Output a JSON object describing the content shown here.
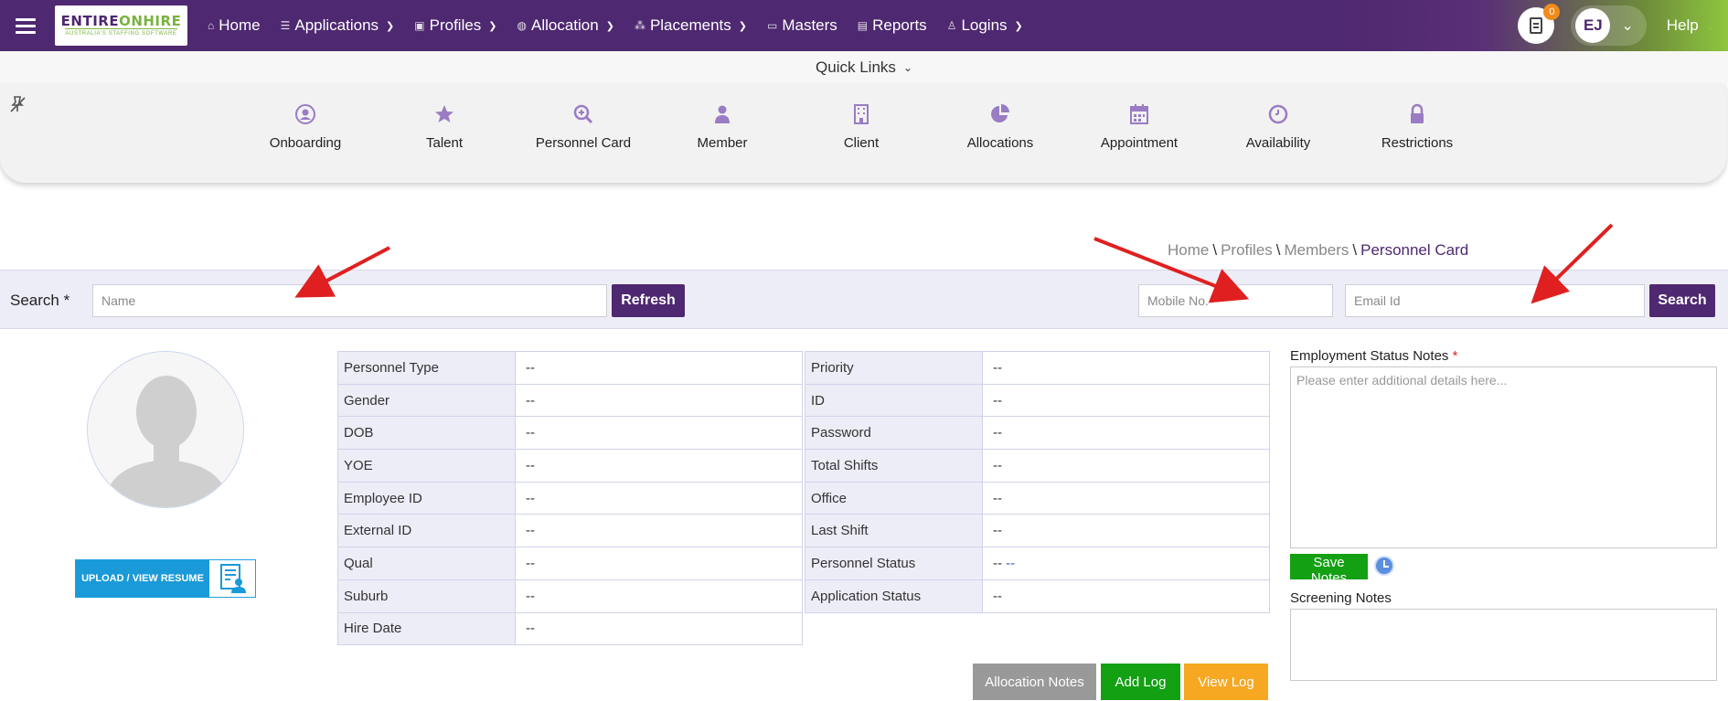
{
  "app": {
    "logo_part1": "ENTIRE",
    "logo_part2": "ONHIRE",
    "logo_tagline": "AUSTRALIA'S STAFFING SOFTWARE"
  },
  "nav": {
    "items": [
      {
        "label": "Home",
        "icon": "home-icon"
      },
      {
        "label": "Applications",
        "icon": "list-icon"
      },
      {
        "label": "Profiles",
        "icon": "profile-card-icon"
      },
      {
        "label": "Allocation",
        "icon": "globe-icon"
      },
      {
        "label": "Placements",
        "icon": "network-icon"
      },
      {
        "label": "Masters",
        "icon": "folder-icon"
      },
      {
        "label": "Reports",
        "icon": "report-icon"
      },
      {
        "label": "Logins",
        "icon": "user-icon"
      }
    ],
    "notification_count": "0",
    "user_initials": "EJ",
    "help_label": "Help"
  },
  "quick_links": {
    "title": "Quick Links",
    "items": [
      {
        "label": "Onboarding",
        "icon": "onboarding-icon"
      },
      {
        "label": "Talent",
        "icon": "star-icon"
      },
      {
        "label": "Personnel Card",
        "icon": "search-plus-icon"
      },
      {
        "label": "Member",
        "icon": "member-icon"
      },
      {
        "label": "Client",
        "icon": "building-icon"
      },
      {
        "label": "Allocations",
        "icon": "pie-chart-icon"
      },
      {
        "label": "Appointment",
        "icon": "calendar-icon"
      },
      {
        "label": "Availability",
        "icon": "clock-icon"
      },
      {
        "label": "Restrictions",
        "icon": "lock-icon"
      }
    ]
  },
  "breadcrumb": {
    "home": "Home",
    "profiles": "Profiles",
    "members": "Members",
    "current": "Personnel Card",
    "separator": "\\"
  },
  "search": {
    "label": "Search",
    "required_mark": "*",
    "name_placeholder": "Name",
    "refresh_label": "Refresh",
    "mobile_placeholder": "Mobile No.",
    "email_placeholder": "Email Id",
    "search_label": "Search"
  },
  "profile": {
    "upload_label": "UPLOAD / VIEW RESUME"
  },
  "details_left": [
    {
      "key": "Personnel Type",
      "value": "--"
    },
    {
      "key": "Gender",
      "value": "--"
    },
    {
      "key": "DOB",
      "value": "--"
    },
    {
      "key": "YOE",
      "value": "--"
    },
    {
      "key": "Employee ID",
      "value": "--"
    },
    {
      "key": "External ID",
      "value": "--"
    },
    {
      "key": "Qual",
      "value": "--"
    },
    {
      "key": "Suburb",
      "value": "--"
    },
    {
      "key": "Hire Date",
      "value": "--"
    }
  ],
  "details_right": [
    {
      "key": "Priority",
      "value": "--"
    },
    {
      "key": "ID",
      "value": "--"
    },
    {
      "key": "Password",
      "value": "--"
    },
    {
      "key": "Total Shifts",
      "value": "--"
    },
    {
      "key": "Office",
      "value": "--"
    },
    {
      "key": "Last Shift",
      "value": "--"
    },
    {
      "key": "Personnel Status",
      "value": "--",
      "link": "--"
    },
    {
      "key": "Application Status",
      "value": "--"
    }
  ],
  "notes": {
    "employment_label": "Employment Status Notes",
    "required_mark": "*",
    "employment_placeholder": "Please enter additional details here...",
    "save_label": "Save Notes",
    "screening_label": "Screening Notes"
  },
  "actions": {
    "allocation_notes": "Allocation Notes",
    "add_log": "Add Log",
    "view_log": "View Log"
  },
  "colors": {
    "brand_purple": "#4e2870",
    "brand_green": "#8dc63f",
    "save_green": "#13a013",
    "allocation_grey": "#999999",
    "view_log_orange": "#f7a823",
    "upload_blue": "#1a9ad8",
    "annotation_red": "#e02020"
  }
}
